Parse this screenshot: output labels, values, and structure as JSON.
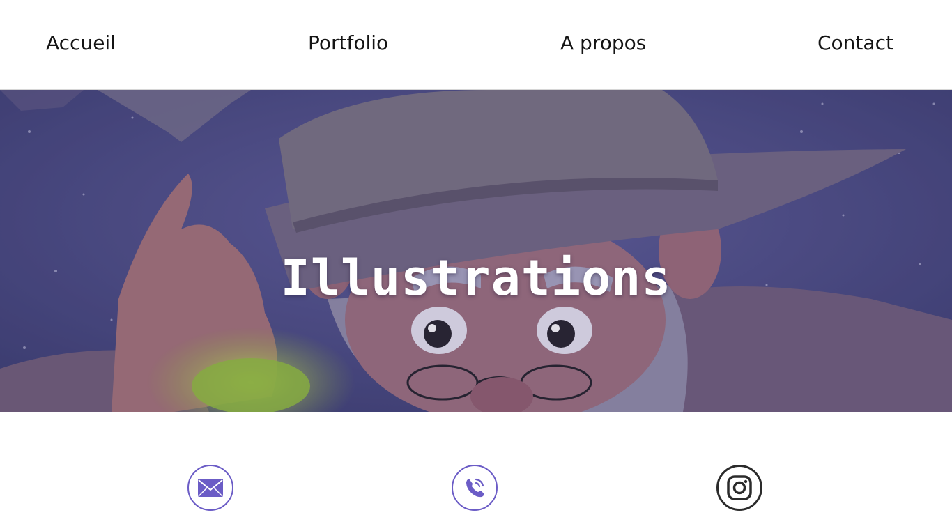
{
  "nav": {
    "items": [
      {
        "label": "Accueil"
      },
      {
        "label": "Portfolio"
      },
      {
        "label": "A propos"
      },
      {
        "label": "Contact"
      }
    ]
  },
  "hero": {
    "title": "Illustrations",
    "background": "wizard-illustration",
    "overlay_color": "#5b4f78"
  },
  "social": {
    "items": [
      {
        "icon": "envelope-icon",
        "color": "#6b5cc6"
      },
      {
        "icon": "phone-icon",
        "color": "#6b5cc6"
      },
      {
        "icon": "instagram-icon",
        "color": "#2b2b2b"
      }
    ]
  },
  "colors": {
    "accent": "#6b5cc6",
    "text": "#141414",
    "background": "#ffffff",
    "sky": "#4a4a86"
  }
}
